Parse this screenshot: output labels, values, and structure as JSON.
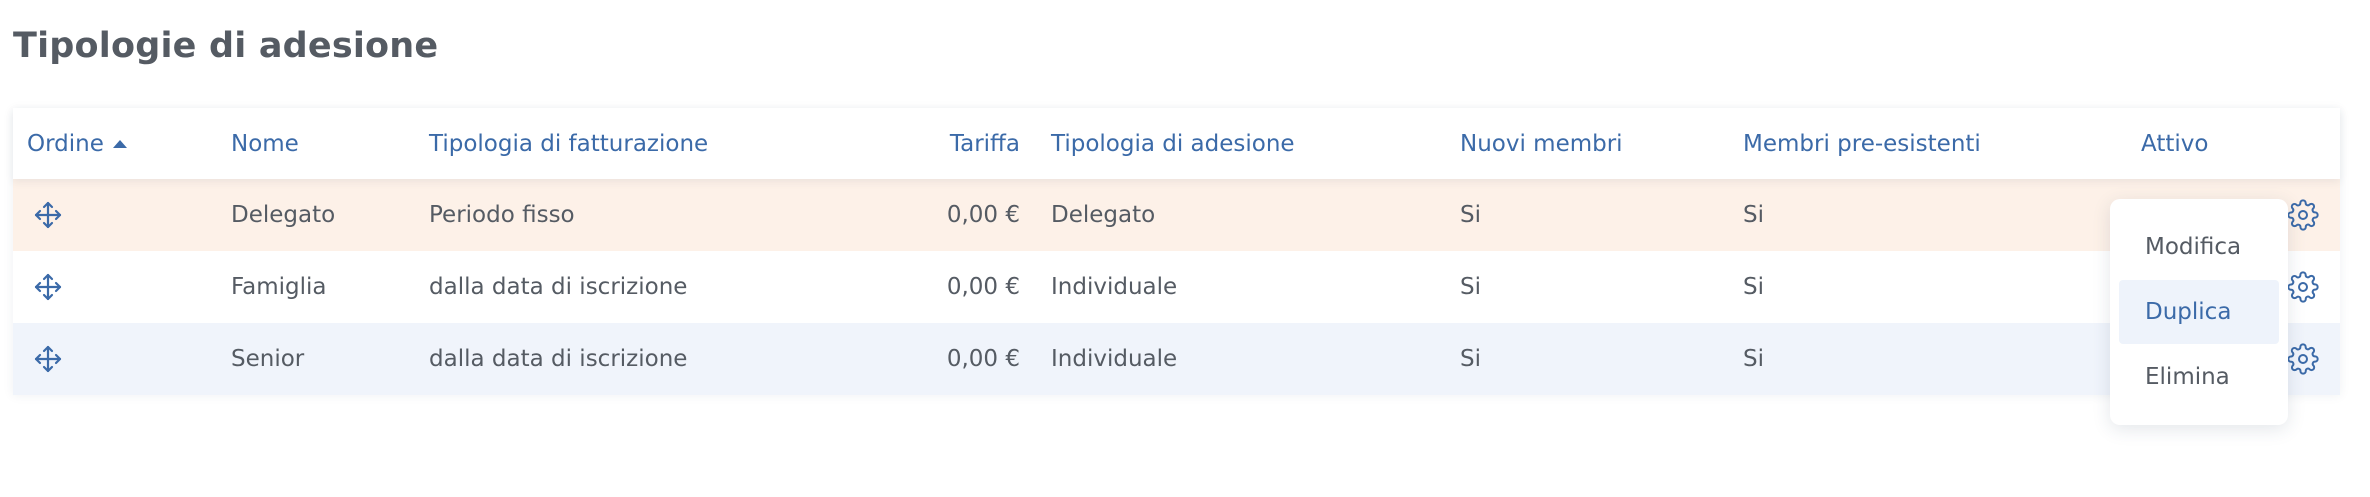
{
  "page": {
    "title": "Tipologie di adesione"
  },
  "table": {
    "headers": {
      "ordine": "Ordine",
      "nome": "Nome",
      "fatturazione": "Tipologia di fatturazione",
      "tariffa": "Tariffa",
      "adesione": "Tipologia di adesione",
      "nuovi": "Nuovi membri",
      "pre": "Membri pre-esistenti",
      "attivo": "Attivo"
    },
    "sort": {
      "column": "Ordine",
      "direction": "ascending",
      "icon": "caret-up-icon"
    },
    "rows": [
      {
        "nome": "Delegato",
        "fatturazione": "Periodo fisso",
        "tariffa": "0,00 €",
        "adesione": "Delegato",
        "nuovi": "Si",
        "pre": "Si",
        "attivo": ""
      },
      {
        "nome": "Famiglia",
        "fatturazione": "dalla data di iscrizione",
        "tariffa": "0,00 €",
        "adesione": "Individuale",
        "nuovi": "Si",
        "pre": "Si",
        "attivo": ""
      },
      {
        "nome": "Senior",
        "fatturazione": "dalla data di iscrizione",
        "tariffa": "0,00 €",
        "adesione": "Individuale",
        "nuovi": "Si",
        "pre": "Si",
        "attivo": ""
      }
    ],
    "row_icons": {
      "drag": "move-arrows-icon",
      "actions": "gear-icon"
    }
  },
  "context_menu": {
    "items": [
      "Modifica",
      "Duplica",
      "Elimina"
    ],
    "highlighted": "Duplica"
  },
  "colors": {
    "accent": "#3b6aa8",
    "text": "#555b63",
    "row_active_bg": "#fdf1e8",
    "row_alt_bg": "#f0f4fb"
  }
}
